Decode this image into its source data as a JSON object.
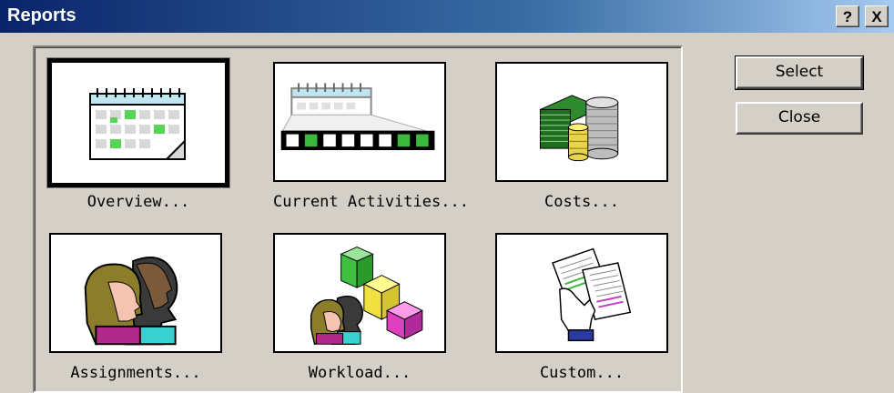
{
  "window": {
    "title": "Reports",
    "help_glyph": "?",
    "close_glyph": "X"
  },
  "reports": [
    {
      "label": "Overview...",
      "icon": "calendar-icon"
    },
    {
      "label": "Current Activities...",
      "icon": "calendar-timeline-icon"
    },
    {
      "label": "Costs...",
      "icon": "money-stack-icon"
    },
    {
      "label": "Assignments...",
      "icon": "people-profile-icon"
    },
    {
      "label": "Workload...",
      "icon": "people-blocks-icon"
    },
    {
      "label": "Custom...",
      "icon": "hand-documents-icon"
    }
  ],
  "buttons": {
    "select": "Select",
    "close": "Close"
  },
  "colors": {
    "titlebar": "#0a246a",
    "dialog_bg": "#d4d0c8"
  }
}
